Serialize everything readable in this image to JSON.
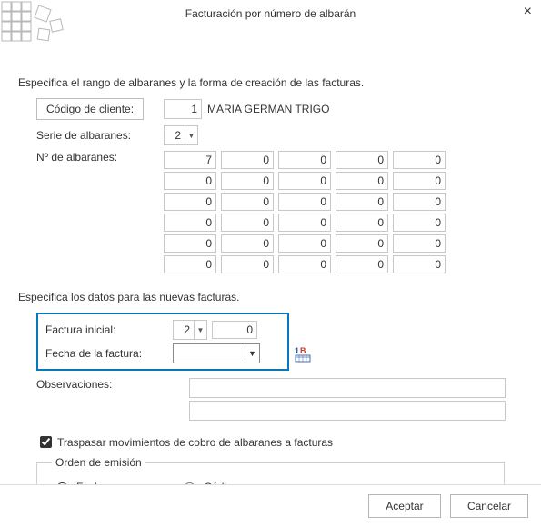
{
  "window": {
    "title": "Facturación por número de albarán"
  },
  "section1": {
    "heading": "Especifica el rango de albaranes y la forma de creación de las facturas.",
    "client_code_button": "Código de cliente:",
    "client_code_value": "1",
    "client_name": "MARIA GERMAN TRIGO",
    "serie_label": "Serie de albaranes:",
    "serie_value": "2",
    "num_albaranes_label": "Nº de albaranes:",
    "grid": [
      [
        "7",
        "0",
        "0",
        "0",
        "0"
      ],
      [
        "0",
        "0",
        "0",
        "0",
        "0"
      ],
      [
        "0",
        "0",
        "0",
        "0",
        "0"
      ],
      [
        "0",
        "0",
        "0",
        "0",
        "0"
      ],
      [
        "0",
        "0",
        "0",
        "0",
        "0"
      ],
      [
        "0",
        "0",
        "0",
        "0",
        "0"
      ]
    ]
  },
  "section2": {
    "heading": "Especifica los datos para las nuevas facturas.",
    "factura_inicial_label": "Factura inicial:",
    "factura_inicial_serie": "2",
    "factura_inicial_num": "0",
    "fecha_label": "Fecha de la factura:",
    "fecha_value": "",
    "obs_label": "Observaciones:",
    "obs1": "",
    "obs2": ""
  },
  "transfer": {
    "checkbox_label": "Traspasar movimientos de cobro de albaranes a facturas",
    "checked": true
  },
  "orden": {
    "legend": "Orden de emisión",
    "fecha_label": "Fecha",
    "codigo_label": "Código"
  },
  "footer": {
    "accept": "Aceptar",
    "cancel": "Cancelar"
  }
}
